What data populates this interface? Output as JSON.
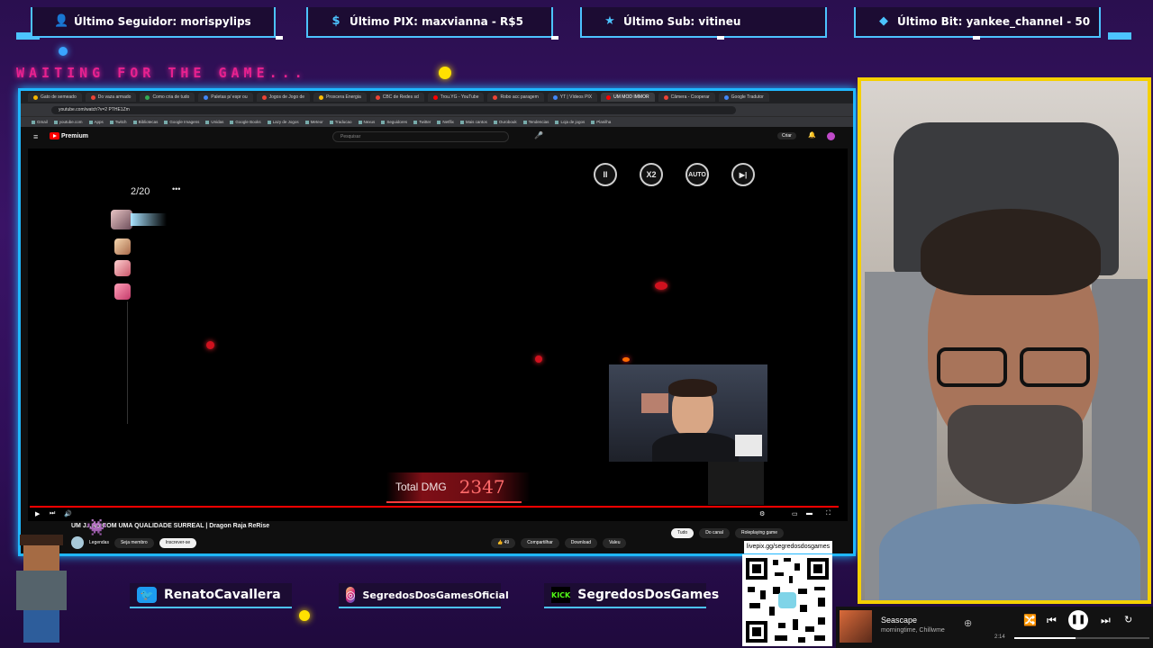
{
  "alerts": [
    {
      "icon": "user-icon",
      "text": "Último Seguidor: morispylips"
    },
    {
      "icon": "dollar-icon",
      "text": "Último PIX: maxvianna - R$5"
    },
    {
      "icon": "star-icon",
      "text": "Último Sub: vitineu"
    },
    {
      "icon": "diamond-icon",
      "text": "Último Bit: yankee_channel - 50"
    }
  ],
  "waiting_text": "WAITING FOR THE GAME...",
  "browser": {
    "tabs": [
      "Gato de semeado",
      "Do vaza armado",
      "Como cria de tudo",
      "Paletas p/ espr ou",
      "Jogos de Jogo de",
      "Proxcera Energia",
      "CBC de Redes sd",
      "Trou.YG - YouTube",
      "Robo acc paragem",
      "YT | Vídeos PIX",
      "UM MOD IMMOR",
      "Câmera - Cooperar",
      "Google Tradutor"
    ],
    "active_tab": 10,
    "address": "youtube.com/watch?v=2 PTHE1Zm",
    "bookmarks": [
      "Gmail",
      "youtube.com",
      "Apps",
      "Twitch",
      "Bibliotecas",
      "Google Imagens",
      "Unidas",
      "Google Books",
      "Lazy de Jogos",
      "Meteor",
      "Traducao",
      "Nexus",
      "Seguidores",
      "Twitter",
      "Netflix",
      "Mais cantos",
      "Ourobouk",
      "Tendencias",
      "Loja de jogos",
      "Planilha"
    ]
  },
  "youtube": {
    "logo": "Premium",
    "search_placeholder": "Pesquisar",
    "create_label": "Criar"
  },
  "game": {
    "wave_counter": "2/20",
    "more": "•••",
    "controls": [
      {
        "name": "pause-button",
        "label": "II"
      },
      {
        "name": "speed-x2-button",
        "label": "X2"
      },
      {
        "name": "auto-button",
        "label": "AUTO"
      },
      {
        "name": "skip-button",
        "label": "▶|"
      }
    ],
    "total_dmg_label": "Total DMG",
    "total_dmg_value": "2347"
  },
  "video": {
    "title": "UM J...AS COM UMA QUALIDADE SURREAL | Dragon Raja ReRise",
    "channel": "Legendas",
    "join": "Seja membro",
    "subscribe": "Inscrever-se",
    "likes": "49",
    "share": "Compartilhar",
    "download": "Download",
    "clip": "Valeu",
    "chips": [
      "Tudo",
      "Do canal",
      "Roleplaying game"
    ]
  },
  "socials": [
    {
      "icon": "twitter-icon",
      "text": "RenatoCavallera"
    },
    {
      "icon": "instagram-icon",
      "text": "SegredosDosGamesOficial"
    },
    {
      "icon": "kick-icon",
      "badge": "KICK",
      "text": "SegredosDosGames"
    }
  ],
  "qr": {
    "url": "livepix.gg/segredosdosgames"
  },
  "music": {
    "track": "Seascape",
    "artist": "morningtime, Chillwme",
    "time": "2:14"
  },
  "colors": {
    "accent": "#4cc3ff",
    "waiting": "#e8218f",
    "webcam_border": "#f5d000",
    "yt_red": "#ff0000"
  }
}
